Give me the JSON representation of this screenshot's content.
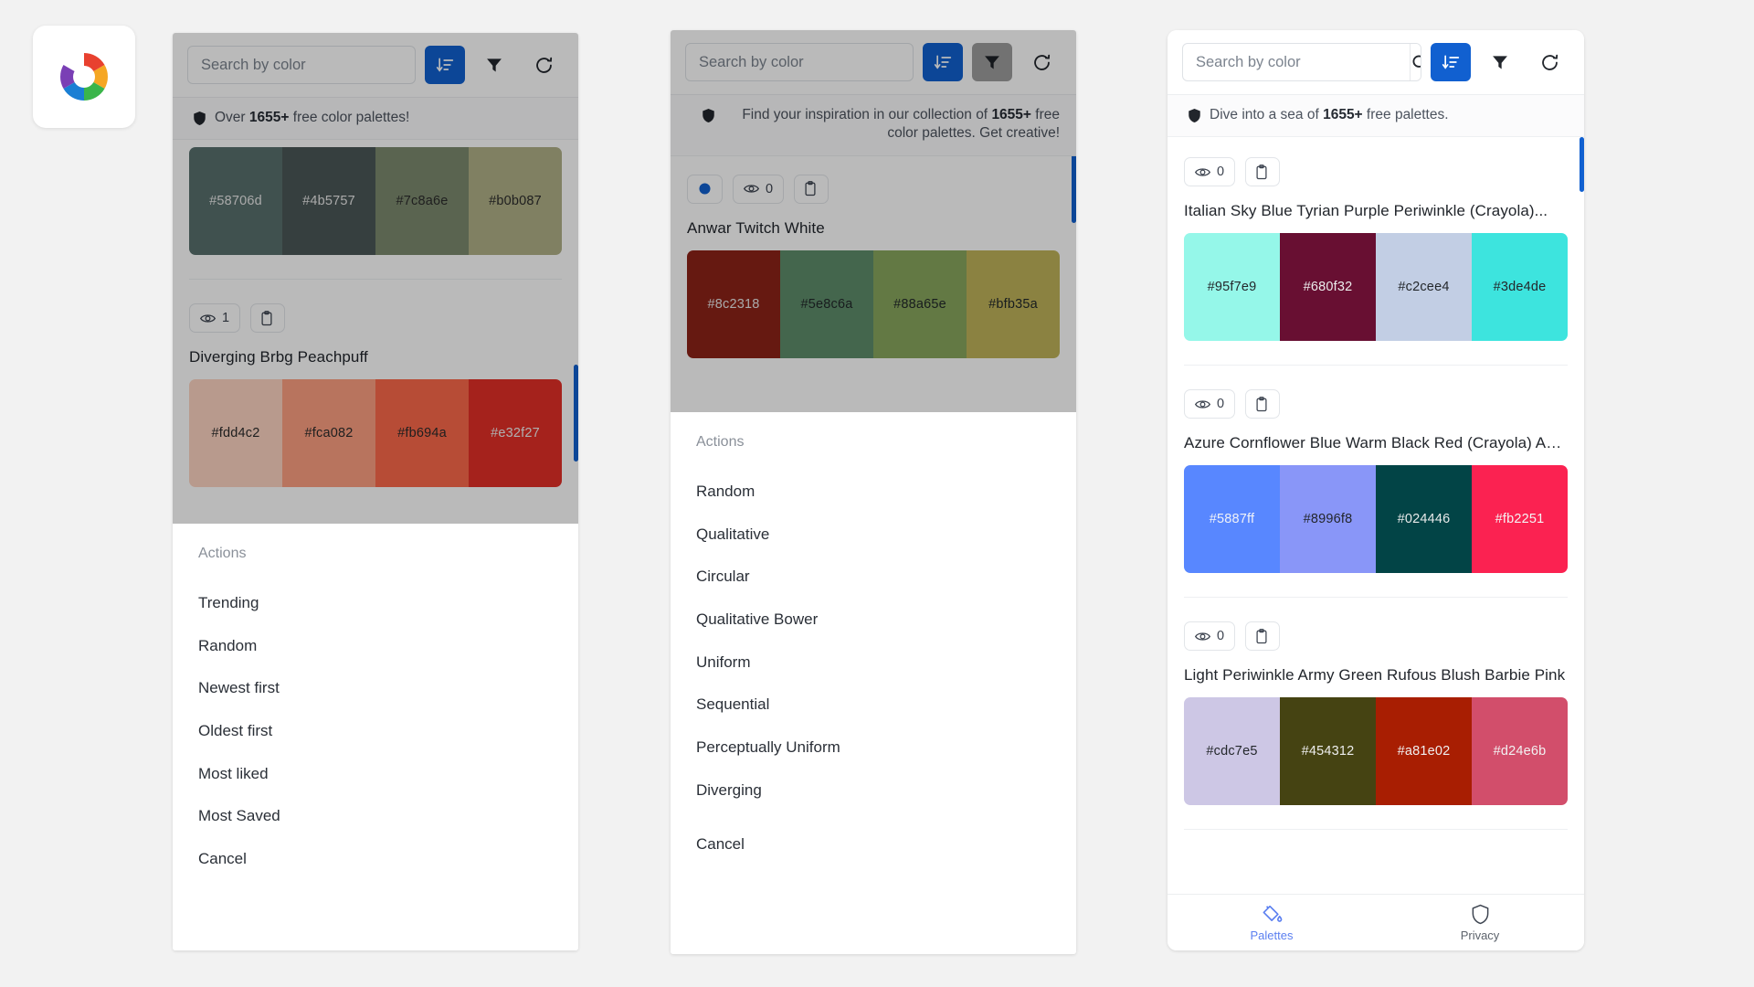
{
  "app": {
    "logo_name": "color-wheel-logo"
  },
  "search": {
    "placeholder": "Search by color",
    "value": ""
  },
  "toolbar": {
    "search_icon": "search-icon",
    "sort_icon": "sort-descending-icon",
    "filter_icon": "filter-icon",
    "refresh_icon": "refresh-icon"
  },
  "panel1": {
    "banner": {
      "prefix": "Over ",
      "count": "1655+",
      "suffix": " free color palettes!",
      "icon": "shield-icon"
    },
    "palettes": [
      {
        "name": "",
        "views": "",
        "swatches": [
          {
            "hex": "#58706d",
            "label": "#58706d",
            "text": "#e8e8e8"
          },
          {
            "hex": "#4b5757",
            "label": "#4b5757",
            "text": "#e8e8e8"
          },
          {
            "hex": "#7c8a6e",
            "label": "#7c8a6e",
            "text": "#2b2b2b"
          },
          {
            "hex": "#b0b087",
            "label": "#b0b087",
            "text": "#2b2b2b"
          }
        ]
      },
      {
        "name": "Diverging Brbg Peachpuff",
        "views": "1",
        "swatches": [
          {
            "hex": "#fdd4c2",
            "label": "#fdd4c2",
            "text": "#2b2b2b"
          },
          {
            "hex": "#fca082",
            "label": "#fca082",
            "text": "#2b2b2b"
          },
          {
            "hex": "#fb694a",
            "label": "#fb694a",
            "text": "#2b2b2b"
          },
          {
            "hex": "#e32f27",
            "label": "#e32f27",
            "text": "#f0f0f0"
          }
        ]
      }
    ],
    "sheet": {
      "title": "Actions",
      "items": [
        "Trending",
        "Random",
        "Newest first",
        "Oldest first",
        "Most liked",
        "Most Saved",
        "Cancel"
      ]
    }
  },
  "panel2": {
    "banner": {
      "prefix": "Find your inspiration in our collection of ",
      "count": "1655+",
      "suffix": " free color palettes. Get creative!",
      "icon": "shield-icon"
    },
    "palette": {
      "name": "Anwar Twitch White",
      "views": "0",
      "dot_icon": "color-dot-icon",
      "swatches": [
        {
          "hex": "#8c2318",
          "label": "#8c2318",
          "text": "#e8e8e8"
        },
        {
          "hex": "#5e8c6a",
          "label": "#5e8c6a",
          "text": "#22282a"
        },
        {
          "hex": "#88a65e",
          "label": "#88a65e",
          "text": "#22282a"
        },
        {
          "hex": "#bfb35a",
          "label": "#bfb35a",
          "text": "#22282a"
        }
      ]
    },
    "sheet": {
      "title": "Actions",
      "items": [
        "Random",
        "Qualitative",
        "Circular",
        "Qualitative Bower",
        "Uniform",
        "Sequential",
        "Perceptually Uniform",
        "Diverging"
      ],
      "cancel": "Cancel"
    }
  },
  "panel3": {
    "banner": {
      "prefix": "Dive into a sea of ",
      "count": "1655+",
      "suffix": " free palettes.",
      "icon": "shield-icon"
    },
    "palettes": [
      {
        "name": "Italian Sky Blue Tyrian Purple Periwinkle (Crayola)...",
        "views": "0",
        "swatches": [
          {
            "hex": "#95f7e9",
            "label": "#95f7e9",
            "text": "#24282c"
          },
          {
            "hex": "#680f32",
            "label": "#680f32",
            "text": "#ececec"
          },
          {
            "hex": "#c2cee4",
            "label": "#c2cee4",
            "text": "#24282c"
          },
          {
            "hex": "#3de4de",
            "label": "#3de4de",
            "text": "#24282c"
          }
        ]
      },
      {
        "name": "Azure Cornflower Blue Warm Black Red (Crayola) Amazon",
        "views": "0",
        "swatches": [
          {
            "hex": "#5887ff",
            "label": "#5887ff",
            "text": "#f0f2f8"
          },
          {
            "hex": "#8996f8",
            "label": "#8996f8",
            "text": "#23262c"
          },
          {
            "hex": "#024446",
            "label": "#024446",
            "text": "#e8eaea"
          },
          {
            "hex": "#fb2251",
            "label": "#fb2251",
            "text": "#f4f4f4"
          }
        ]
      },
      {
        "name": "Light Periwinkle Army Green Rufous Blush Barbie Pink",
        "views": "0",
        "swatches": [
          {
            "hex": "#cdc7e5",
            "label": "#cdc7e5",
            "text": "#24282c"
          },
          {
            "hex": "#454312",
            "label": "#454312",
            "text": "#ededed"
          },
          {
            "hex": "#a81e02",
            "label": "#a81e02",
            "text": "#f0f0f0"
          },
          {
            "hex": "#d24e6b",
            "label": "#d24e6b",
            "text": "#f2f2f2"
          }
        ]
      }
    ],
    "tabs": [
      {
        "label": "Palettes",
        "icon": "paint-bucket-icon",
        "active": true
      },
      {
        "label": "Privacy",
        "icon": "shield-icon",
        "active": false
      }
    ]
  },
  "colors": {
    "primary": "#1160d0",
    "accent": "#5b7ff0",
    "sheet_bg": "#ffffff",
    "scrim": "rgba(0,0,0,0.27)"
  }
}
